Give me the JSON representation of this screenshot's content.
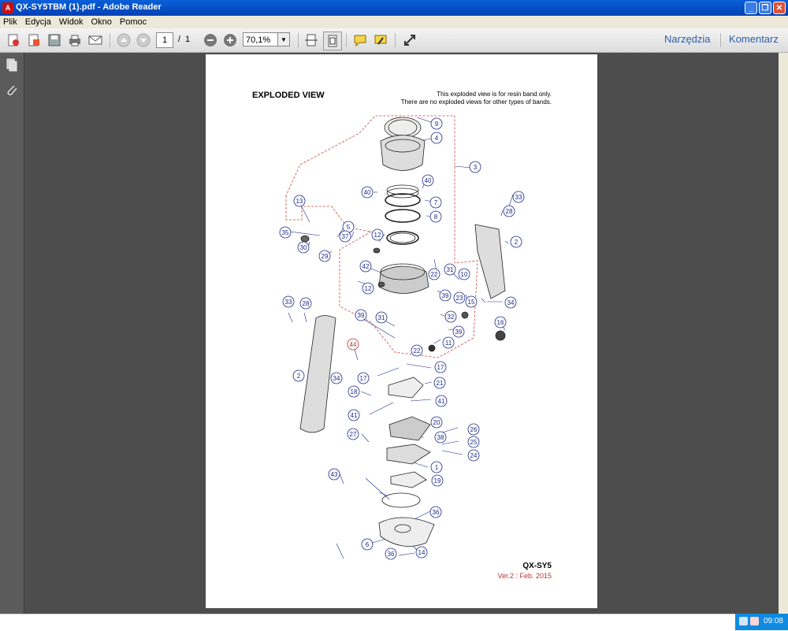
{
  "window": {
    "title": "QX-SY5TBM (1).pdf - Adobe Reader",
    "app_icon_text": "A"
  },
  "menu": [
    "Plik",
    "Edycja",
    "Widok",
    "Okno",
    "Pomoc"
  ],
  "toolbar": {
    "page_current": "1",
    "page_sep": "/",
    "page_total": "1",
    "zoom": "70,1%",
    "tools_label": "Narzędzia",
    "comment_label": "Komentarz",
    "icons": [
      "create-pdf-icon",
      "convert-icon",
      "save-icon",
      "print-icon",
      "email-icon",
      "prev-page-icon",
      "next-page-icon",
      "zoom-out-icon",
      "zoom-in-icon",
      "fit-width-icon",
      "fit-page-icon",
      "comment-icon",
      "highlight-icon",
      "fullscreen-icon"
    ]
  },
  "sidebar": {
    "icons": [
      "pages-icon",
      "attachment-icon"
    ]
  },
  "document": {
    "title": "EXPLODED VIEW",
    "note_line1": "This exploded view is for resin band only.",
    "note_line2": "There are no exploded views for other types of bands.",
    "model": "QX-SY5",
    "version": "Ver.2 : Feb. 2015",
    "version_color": "#c03030",
    "callout_color": "#1c2a8a",
    "red_callout": "44",
    "callouts": [
      "9",
      "4",
      "3",
      "40",
      "40",
      "7",
      "8",
      "13",
      "33",
      "28",
      "35",
      "5",
      "37",
      "30",
      "29",
      "12",
      "2",
      "42",
      "12",
      "22",
      "31",
      "10",
      "39",
      "23",
      "15",
      "34",
      "33",
      "28",
      "39",
      "31",
      "32",
      "16",
      "39",
      "11",
      "22",
      "44",
      "17",
      "17",
      "21",
      "18",
      "41",
      "41",
      "20",
      "27",
      "38",
      "26",
      "25",
      "24",
      "1",
      "43",
      "19",
      "6",
      "14",
      "36",
      "36",
      "2",
      "34"
    ]
  },
  "tray": {
    "clock": "09:08"
  }
}
